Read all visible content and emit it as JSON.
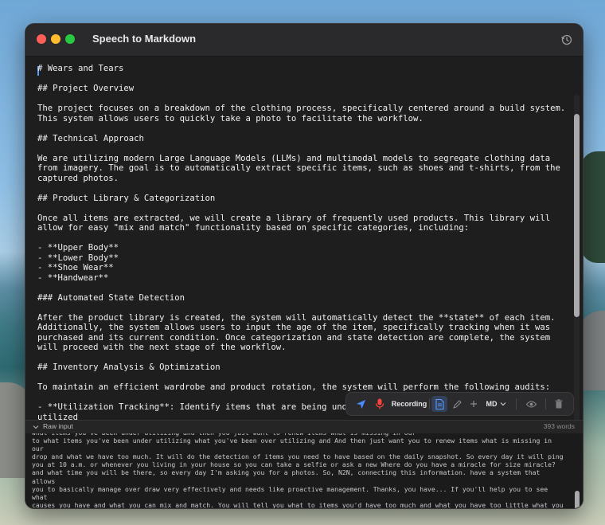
{
  "window": {
    "title": "Speech to Markdown"
  },
  "editor": {
    "content": "# Wears and Tears\n\n## Project Overview\n\nThe project focuses on a breakdown of the clothing process, specifically centered around a build system.\nThis system allows users to quickly take a photo to facilitate the workflow.\n\n## Technical Approach\n\nWe are utilizing modern Large Language Models (LLMs) and multimodal models to segregate clothing data\nfrom imagery. The goal is to automatically extract specific items, such as shoes and t-shirts, from the\ncaptured photos.\n\n## Product Library & Categorization\n\nOnce all items are extracted, we will create a library of frequently used products. This library will\nallow for easy \"mix and match\" functionality based on specific categories, including:\n\n- **Upper Body**\n- **Lower Body**\n- **Shoe Wear**\n- **Handwear**\n\n### Automated State Detection\n\nAfter the product library is created, the system will automatically detect the **state** of each item.\nAdditionally, the system allows users to input the age of the item, specifically tracking when it was\npurchased and its current condition. Once categorization and state detection are complete, the system\nwill proceed with the next stage of the workflow.\n\n## Inventory Analysis & Optimization\n\nTo maintain an efficient wardrobe and product rotation, the system will perform the following audits:\n\n- **Utilization Tracking**: Identify items that are being underutilized.\nutilized"
  },
  "toolbar": {
    "recording_label": "Recording",
    "format_label": "MD",
    "icons": [
      "send-icon",
      "microphone-icon",
      "document-icon",
      "pencil-icon",
      "plus-icon",
      "chevron-down-icon",
      "eye-icon",
      "trash-icon"
    ],
    "colors": {
      "send": "#4a8cff",
      "mic": "#ff453a",
      "active_bg": "#33415a"
    }
  },
  "raw_input": {
    "label": "Raw input",
    "word_count": "393 words",
    "text": "what items you've been under utilizing and then you just want to renew items what is missing in our\nto what items you've been under utilizing what you've been over utilizing and And then just want you to renew items what is missing in our\ndrop and what we have too much. It will do the detection of items you need to have based on the daily snapshot. So every day it will ping\nyou at 10 a.m. or whenever you living in your house so you can take a selfie or ask a new Where do you have a miracle for size miracle?\nand what time you will be there, so every day I'm asking you for a photos. So, N2N, connecting this information. have a system that allows\nyou to basically manage over draw very effectively and needs like proactive management. Thanks, you have... If you'll help you to see what\ncauses you have and what you can mix and match. You will tell you what to items you'd have too much and what you have too little what you\nover you'd utilizing what you're under utilizing and then you need to renew some items from your wardrobe. because of wares and terrors.\nThank you. Thank you."
  }
}
